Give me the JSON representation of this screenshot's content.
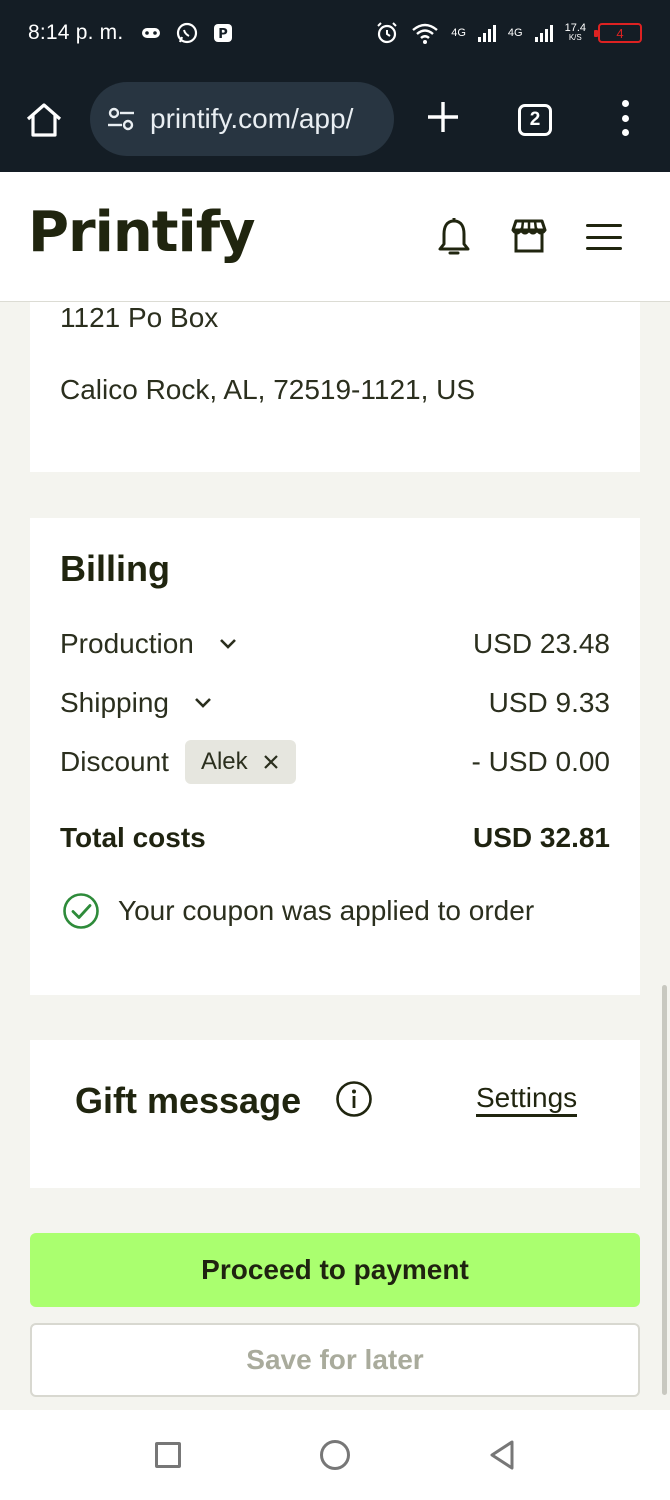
{
  "status_bar": {
    "time": "8:14 p. m.",
    "network_1": "4G",
    "network_2": "4G",
    "speed_value": "17.4",
    "speed_unit": "K/S",
    "battery": "4"
  },
  "browser": {
    "url": "printify.com/app/",
    "tab_count": "2"
  },
  "app": {
    "logo_text": "Printify"
  },
  "address": {
    "line1": "1121 Po Box",
    "line2": "Calico Rock, AL, 72519-1121, US"
  },
  "billing": {
    "title": "Billing",
    "production_label": "Production",
    "production_value": "USD 23.48",
    "shipping_label": "Shipping",
    "shipping_value": "USD 9.33",
    "discount_label": "Discount",
    "coupon_code": "Alek",
    "discount_value": "- USD 0.00",
    "total_label": "Total costs",
    "total_value": "USD 32.81",
    "coupon_message": "Your coupon was applied to order"
  },
  "gift": {
    "title": "Gift message",
    "settings_link": "Settings"
  },
  "actions": {
    "proceed_label": "Proceed to payment",
    "save_label": "Save for later"
  },
  "colors": {
    "primary_button": "#aaff6f",
    "success_green": "#2e8b3a",
    "browser_bar": "#141d25"
  }
}
